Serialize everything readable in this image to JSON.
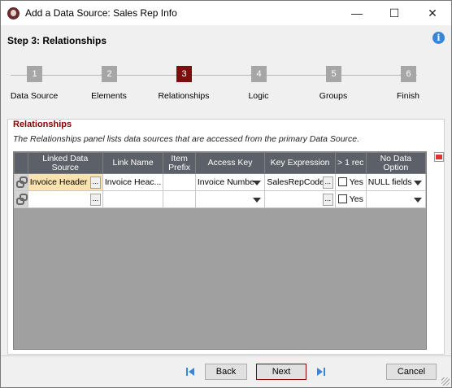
{
  "window": {
    "title": "Add a Data Source: Sales Rep Info",
    "controls": {
      "minimize": "—",
      "maximize": "☐",
      "close": "✕"
    }
  },
  "header": {
    "step_title": "Step 3: Relationships",
    "info_icon": "i"
  },
  "steps": [
    {
      "number": "1",
      "label": "Data Source"
    },
    {
      "number": "2",
      "label": "Elements"
    },
    {
      "number": "3",
      "label": "Relationships"
    },
    {
      "number": "4",
      "label": "Logic"
    },
    {
      "number": "5",
      "label": "Groups"
    },
    {
      "number": "6",
      "label": "Finish"
    }
  ],
  "active_step": "3",
  "colors": {
    "accent": "#7b0f0f",
    "inactive_step": "#a6a6a6",
    "section_title": "#8b0000",
    "grid_header": "#5c6068"
  },
  "section": {
    "title": "Relationships",
    "description": "The Relationships panel lists data sources that are accessed from the primary Data Source."
  },
  "grid": {
    "columns": [
      "Linked Data Source",
      "Link Name",
      "Item Prefix",
      "Access Key",
      "Key Expression",
      "> 1 rec",
      "No Data Option"
    ],
    "rows": [
      {
        "linked_data_source": "Invoice Header",
        "link_name": "Invoice Heac...",
        "item_prefix": "",
        "access_key": "Invoice Numbe",
        "key_expression": "SalesRepCode",
        "more_than_one_rec": "Yes",
        "no_data_option": "NULL fields"
      },
      {
        "linked_data_source": "",
        "link_name": "",
        "item_prefix": "",
        "access_key": "",
        "key_expression": "",
        "more_than_one_rec": "Yes",
        "no_data_option": ""
      }
    ],
    "ellipsis": "..."
  },
  "footer": {
    "back": "Back",
    "next": "Next",
    "cancel": "Cancel"
  }
}
